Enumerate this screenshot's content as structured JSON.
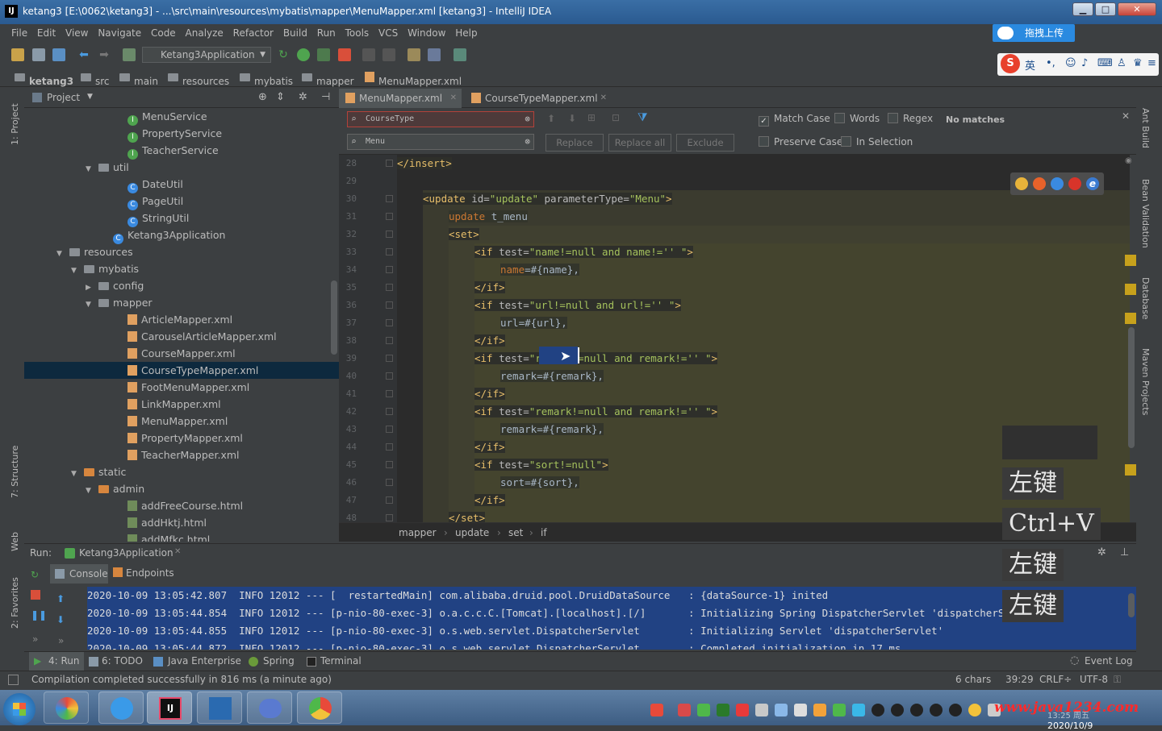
{
  "window": {
    "title": "ketang3 [E:\\0062\\ketang3] - ...\\src\\main\\resources\\mybatis\\mapper\\MenuMapper.xml [ketang3] - IntelliJ IDEA",
    "icon": "intellij-icon",
    "min": "▁",
    "max": "□",
    "close": "✕"
  },
  "menu": [
    "File",
    "Edit",
    "View",
    "Navigate",
    "Code",
    "Analyze",
    "Refactor",
    "Build",
    "Run",
    "Tools",
    "VCS",
    "Window",
    "Help"
  ],
  "upload_label": "拖拽上传",
  "run_config": "Ketang3Application",
  "breadcrumbs": [
    "ketang3",
    "src",
    "main",
    "resources",
    "mybatis",
    "mapper",
    "MenuMapper.xml"
  ],
  "left_stripe": {
    "project": "1: Project",
    "structure": "7: Structure",
    "web": "Web",
    "favorites": "2: Favorites"
  },
  "right_stripe": {
    "ant": "Ant Build",
    "bean": "Bean Validation",
    "database": "Database",
    "maven": "Maven Projects"
  },
  "project": {
    "title": "Project",
    "tree": [
      {
        "label": "MenuService",
        "icon": "interface-icon",
        "indent": 7
      },
      {
        "label": "PropertyService",
        "icon": "interface-icon",
        "indent": 7
      },
      {
        "label": "TeacherService",
        "icon": "interface-icon",
        "indent": 7
      },
      {
        "label": "util",
        "icon": "folder-icon",
        "indent": 5,
        "arrow": "▼"
      },
      {
        "label": "DateUtil",
        "icon": "class-icon",
        "indent": 7
      },
      {
        "label": "PageUtil",
        "icon": "class-icon",
        "indent": 7
      },
      {
        "label": "StringUtil",
        "icon": "class-icon",
        "indent": 7
      },
      {
        "label": "Ketang3Application",
        "icon": "spring-class-icon",
        "indent": 6
      },
      {
        "label": "resources",
        "icon": "folder-icon",
        "indent": 3,
        "arrow": "▼"
      },
      {
        "label": "mybatis",
        "icon": "folder-icon",
        "indent": 4,
        "arrow": "▼"
      },
      {
        "label": "config",
        "icon": "folder-icon",
        "indent": 5,
        "arrow": "▶"
      },
      {
        "label": "mapper",
        "icon": "folder-icon",
        "indent": 5,
        "arrow": "▼"
      },
      {
        "label": "ArticleMapper.xml",
        "icon": "xml-icon",
        "indent": 7
      },
      {
        "label": "CarouselArticleMapper.xml",
        "icon": "xml-icon",
        "indent": 7
      },
      {
        "label": "CourseMapper.xml",
        "icon": "xml-icon",
        "indent": 7
      },
      {
        "label": "CourseTypeMapper.xml",
        "icon": "xml-icon",
        "indent": 7,
        "selected": true
      },
      {
        "label": "FootMenuMapper.xml",
        "icon": "xml-icon",
        "indent": 7
      },
      {
        "label": "LinkMapper.xml",
        "icon": "xml-icon",
        "indent": 7
      },
      {
        "label": "MenuMapper.xml",
        "icon": "xml-icon",
        "indent": 7
      },
      {
        "label": "PropertyMapper.xml",
        "icon": "xml-icon",
        "indent": 7
      },
      {
        "label": "TeacherMapper.xml",
        "icon": "xml-icon",
        "indent": 7
      },
      {
        "label": "static",
        "icon": "folder-orange-icon",
        "indent": 4,
        "arrow": "▼"
      },
      {
        "label": "admin",
        "icon": "folder-orange-icon",
        "indent": 5,
        "arrow": "▼"
      },
      {
        "label": "addFreeCourse.html",
        "icon": "html-icon",
        "indent": 7
      },
      {
        "label": "addHktj.html",
        "icon": "html-icon",
        "indent": 7
      },
      {
        "label": "addMfkc.html",
        "icon": "html-icon",
        "indent": 7
      }
    ]
  },
  "tabs": [
    {
      "label": "MenuMapper.xml",
      "active": true
    },
    {
      "label": "CourseTypeMapper.xml",
      "active": false
    }
  ],
  "find": {
    "search_value": "CourseType",
    "replace_value": "Menu",
    "replace": "Replace",
    "replace_all": "Replace all",
    "exclude": "Exclude",
    "match_case": "Match Case",
    "words": "Words",
    "regex": "Regex",
    "no_matches": "No matches",
    "preserve_case": "Preserve Case",
    "in_selection": "In Selection"
  },
  "code": {
    "lines": [
      {
        "n": "28",
        "i": 0,
        "parts": [
          [
            "tag",
            "</insert>"
          ]
        ]
      },
      {
        "n": "29",
        "i": 0,
        "parts": []
      },
      {
        "n": "30",
        "i": 1,
        "parts": [
          [
            "tag",
            "<update "
          ],
          [
            "atn",
            "id="
          ],
          [
            "atv",
            "\"update\" "
          ],
          [
            "atn",
            "parameterType="
          ],
          [
            "atv",
            "\"Menu\""
          ],
          [
            "tag",
            ">"
          ]
        ]
      },
      {
        "n": "31",
        "i": 2,
        "parts": [
          [
            "kw",
            "update "
          ],
          [
            "txt",
            "t_menu"
          ]
        ]
      },
      {
        "n": "32",
        "i": 2,
        "parts": [
          [
            "tag",
            "<set>"
          ]
        ]
      },
      {
        "n": "33",
        "i": 3,
        "parts": [
          [
            "tag",
            "<if "
          ],
          [
            "atn",
            "test="
          ],
          [
            "atv",
            "\"name!=null and name!='' \""
          ],
          [
            "tag",
            ">"
          ]
        ]
      },
      {
        "n": "34",
        "i": 4,
        "parts": [
          [
            "kw",
            "name"
          ],
          [
            "txt",
            "=#{name},"
          ]
        ]
      },
      {
        "n": "35",
        "i": 3,
        "parts": [
          [
            "tag",
            "</if>"
          ]
        ]
      },
      {
        "n": "36",
        "i": 3,
        "parts": [
          [
            "tag",
            "<if "
          ],
          [
            "atn",
            "test="
          ],
          [
            "atv",
            "\"url!=null and url!='' \""
          ],
          [
            "tag",
            ">"
          ]
        ]
      },
      {
        "n": "37",
        "i": 4,
        "parts": [
          [
            "txt",
            "url=#{url},"
          ]
        ]
      },
      {
        "n": "38",
        "i": 3,
        "parts": [
          [
            "tag",
            "</if>"
          ]
        ]
      },
      {
        "n": "39",
        "i": 3,
        "parts": [
          [
            "tag",
            "<if "
          ],
          [
            "atn",
            "test="
          ],
          [
            "atv",
            "\"remark!=null and remark!='' \""
          ],
          [
            "tag",
            ">"
          ]
        ]
      },
      {
        "n": "40",
        "i": 4,
        "parts": [
          [
            "txt",
            "remark=#{remark},"
          ]
        ]
      },
      {
        "n": "41",
        "i": 3,
        "parts": [
          [
            "tag",
            "</if>"
          ]
        ]
      },
      {
        "n": "42",
        "i": 3,
        "parts": [
          [
            "tag",
            "<if "
          ],
          [
            "atn",
            "test="
          ],
          [
            "atv",
            "\"remark!=null and remark!='' \""
          ],
          [
            "tag",
            ">"
          ]
        ]
      },
      {
        "n": "43",
        "i": 4,
        "parts": [
          [
            "txt",
            "remark=#{remark},"
          ]
        ]
      },
      {
        "n": "44",
        "i": 3,
        "parts": [
          [
            "tag",
            "</if>"
          ]
        ]
      },
      {
        "n": "45",
        "i": 3,
        "parts": [
          [
            "tag",
            "<if "
          ],
          [
            "atn",
            "test="
          ],
          [
            "atv",
            "\"sort!=null\""
          ],
          [
            "tag",
            ">"
          ]
        ]
      },
      {
        "n": "46",
        "i": 4,
        "parts": [
          [
            "txt",
            "sort=#{sort},"
          ]
        ]
      },
      {
        "n": "47",
        "i": 3,
        "parts": [
          [
            "tag",
            "</if>"
          ]
        ]
      },
      {
        "n": "48",
        "i": 2,
        "parts": [
          [
            "tag",
            "</set>"
          ]
        ]
      }
    ]
  },
  "code_breadcrumb": [
    "mapper",
    "update",
    "set",
    "if"
  ],
  "run": {
    "label": "Run:",
    "config": "Ketang3Application",
    "console_tab": "Console",
    "endpoints_tab": "Endpoints",
    "log": [
      "2020-10-09 13:05:42.807  INFO 12012 --- [  restartedMain] com.alibaba.druid.pool.DruidDataSource   : {dataSource-1} inited",
      "2020-10-09 13:05:44.854  INFO 12012 --- [p-nio-80-exec-3] o.a.c.c.C.[Tomcat].[localhost].[/]       : Initializing Spring DispatcherServlet 'dispatcherServlet'",
      "2020-10-09 13:05:44.855  INFO 12012 --- [p-nio-80-exec-3] o.s.web.servlet.DispatcherServlet        : Initializing Servlet 'dispatcherServlet'",
      "2020-10-09 13:05:44.872  INFO 12012 --- [p-nio-80-exec-3] o.s.web.servlet.DispatcherServlet        : Completed initialization in 17 ms"
    ]
  },
  "bottom_tabs": [
    "4: Run",
    "6: TODO",
    "Java Enterprise",
    "Spring",
    "Terminal"
  ],
  "event_log": "Event Log",
  "status": {
    "message": "Compilation completed successfully in 816 ms (a minute ago)",
    "chars": "6 chars",
    "position": "39:29",
    "line_sep": "CRLF÷",
    "encoding": "UTF-8"
  },
  "key_overlay": [
    "左键",
    "Ctrl+V",
    "左键",
    "左键"
  ],
  "ime": {
    "logo": "S",
    "lang": "英"
  },
  "watermark": "www.java1234.com",
  "clock": {
    "time": "13:25 周五",
    "date": "2020/10/9"
  },
  "colors": {
    "accent": "#214283",
    "selection": "#0d293e",
    "tag": "#e8bf6a",
    "string": "#a5c25c",
    "keyword": "#cc7832"
  }
}
